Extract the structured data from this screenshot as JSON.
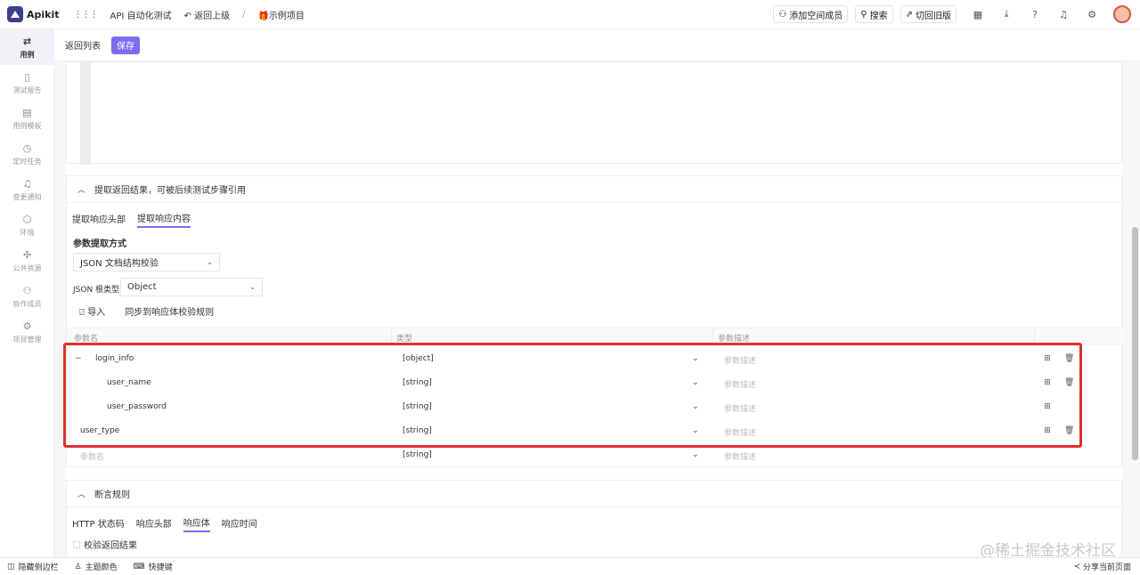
{
  "topbar": {
    "brand": "Apikit",
    "project_nav": "API 自动化测试",
    "back_label": "返回上级",
    "separator": "/",
    "current": "示例项目",
    "add_member": "添加空间成员",
    "search": "搜索",
    "switch_old": "切回旧版"
  },
  "sidebar": {
    "items": [
      {
        "label": "用例",
        "icon": "swap-icon"
      },
      {
        "label": "测试报告",
        "icon": "report-icon"
      },
      {
        "label": "用例模板",
        "icon": "template-icon"
      },
      {
        "label": "定时任务",
        "icon": "clock-icon"
      },
      {
        "label": "变更通知",
        "icon": "bell-icon"
      },
      {
        "label": "环境",
        "icon": "env-icon"
      },
      {
        "label": "公共资源",
        "icon": "puzzle-icon"
      },
      {
        "label": "协作成员",
        "icon": "users-icon"
      },
      {
        "label": "项目管理",
        "icon": "gear-icon"
      }
    ]
  },
  "toolbar": {
    "back_to_list": "返回列表",
    "save": "保存"
  },
  "extract": {
    "title": "提取返回结果，可被后续测试步骤引用",
    "tabs": [
      "提取响应头部",
      "提取响应内容"
    ],
    "method_label": "参数提取方式",
    "method_value": "JSON 文档结构校验",
    "root_type_label": "JSON 根类型:",
    "root_type_value": "Object",
    "import": "导入",
    "sync": "同步到响应体校验规则",
    "columns": [
      "参数名",
      "类型",
      "参数描述"
    ],
    "rows": [
      {
        "name": "login_info",
        "type": "[object]",
        "desc": "参数描述"
      },
      {
        "name": "user_name",
        "type": "[string]",
        "desc": "参数描述"
      },
      {
        "name": "user_password",
        "type": "[string]",
        "desc": "参数描述"
      },
      {
        "name": "user_type",
        "type": "[string]",
        "desc": "参数描述"
      },
      {
        "name": "参数名",
        "type": "[string]",
        "desc": "参数描述"
      }
    ]
  },
  "assert": {
    "title": "断言规则",
    "tabs": [
      "HTTP 状态码",
      "响应头部",
      "响应体",
      "响应时间"
    ],
    "checkbox": "校验返回结果"
  },
  "bottombar": {
    "hide_sidebar": "隐藏侧边栏",
    "theme": "主题颜色",
    "shortcuts": "快捷键",
    "share": "分享当前页面"
  },
  "watermark": "@稀土掘金技术社区",
  "colors": {
    "accent": "#7a6df0",
    "highlight": "#e0302f"
  }
}
